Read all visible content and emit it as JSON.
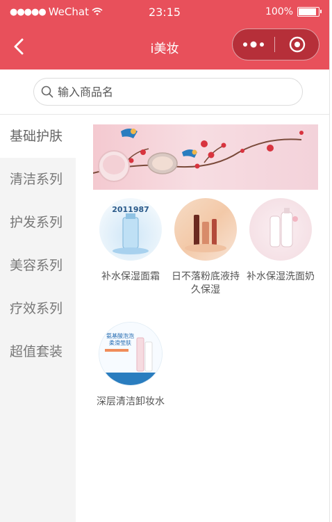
{
  "status_bar": {
    "carrier": "WeChat",
    "time": "23:15",
    "battery": "100%"
  },
  "nav": {
    "title": "i美妆"
  },
  "search": {
    "placeholder": "输入商品名"
  },
  "sidebar": {
    "items": [
      {
        "label": "基础护肤"
      },
      {
        "label": "清洁系列"
      },
      {
        "label": "护发系列"
      },
      {
        "label": "美容系列"
      },
      {
        "label": "疗效系列"
      },
      {
        "label": "超值套装"
      }
    ]
  },
  "products": [
    {
      "name": "补水保湿面霜",
      "thumb_text": "2011987"
    },
    {
      "name": "日不落粉底液持久保湿"
    },
    {
      "name": "补水保湿洗面奶"
    },
    {
      "name": "深层清洁卸妆水",
      "thumb_text_1": "氨基酸泡泡",
      "thumb_text_2": "柔滑莹肤"
    }
  ],
  "colors": {
    "brand": "#e8505b",
    "sidebar_bg": "#f4f4f4"
  }
}
